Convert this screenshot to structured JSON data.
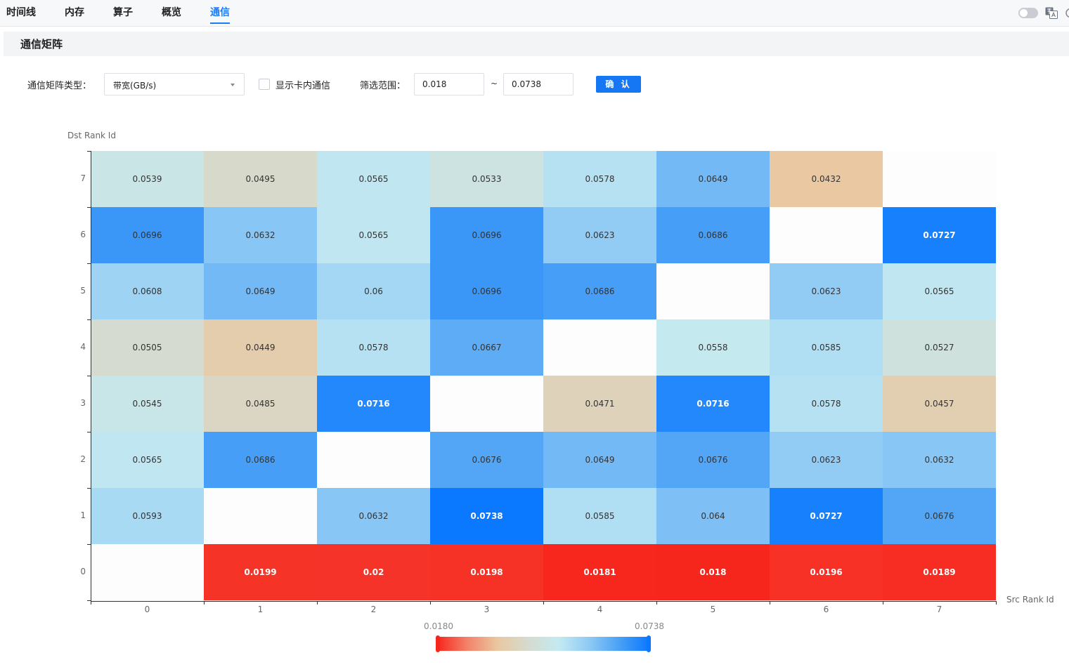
{
  "tabs": [
    {
      "label": "时间线",
      "active": false
    },
    {
      "label": "内存",
      "active": false
    },
    {
      "label": "算子",
      "active": false
    },
    {
      "label": "概览",
      "active": false
    },
    {
      "label": "通信",
      "active": true
    }
  ],
  "panel": {
    "title": "通信矩阵"
  },
  "controls": {
    "matrix_type_label": "通信矩阵类型：",
    "matrix_type_value": "带宽(GB/s)",
    "show_intra_label": "显示卡内通信",
    "show_intra_checked": false,
    "filter_label": "筛选范围：",
    "filter_min": "0.018",
    "tilde": "~",
    "filter_max": "0.0738",
    "confirm_label": "确 认"
  },
  "colors": {
    "accent": "#1677f5",
    "low": "#f7261d",
    "high": "#0a78ff"
  },
  "chart_data": {
    "type": "heatmap",
    "xlabel": "Src Rank Id",
    "ylabel": "Dst Rank Id",
    "x_categories": [
      "0",
      "1",
      "2",
      "3",
      "4",
      "5",
      "6",
      "7"
    ],
    "y_categories": [
      "0",
      "1",
      "2",
      "3",
      "4",
      "5",
      "6",
      "7"
    ],
    "matrix": [
      [
        null,
        "0.0199",
        "0.02",
        "0.0198",
        "0.0181",
        "0.018",
        "0.0196",
        "0.0189"
      ],
      [
        "0.0593",
        null,
        "0.0632",
        "0.0738",
        "0.0585",
        "0.064",
        "0.0727",
        "0.0676"
      ],
      [
        "0.0565",
        "0.0686",
        null,
        "0.0676",
        "0.0649",
        "0.0676",
        "0.0623",
        "0.0632"
      ],
      [
        "0.0545",
        "0.0485",
        "0.0716",
        null,
        "0.0471",
        "0.0716",
        "0.0578",
        "0.0457"
      ],
      [
        "0.0505",
        "0.0449",
        "0.0578",
        "0.0667",
        null,
        "0.0558",
        "0.0585",
        "0.0527"
      ],
      [
        "0.0608",
        "0.0649",
        "0.06",
        "0.0696",
        "0.0686",
        null,
        "0.0623",
        "0.0565"
      ],
      [
        "0.0696",
        "0.0632",
        "0.0565",
        "0.0696",
        "0.0623",
        "0.0686",
        null,
        "0.0727"
      ],
      [
        "0.0539",
        "0.0495",
        "0.0565",
        "0.0533",
        "0.0578",
        "0.0649",
        "0.0432",
        null
      ]
    ],
    "visual_map": {
      "min": "0.0180",
      "max": "0.0738"
    }
  }
}
